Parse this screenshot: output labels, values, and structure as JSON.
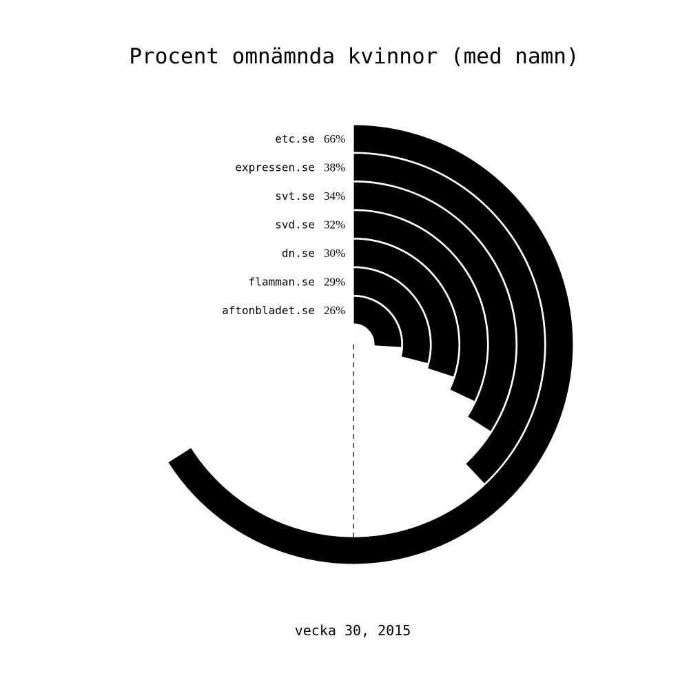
{
  "chart_data": {
    "type": "radial-bar",
    "title": "Procent omnämnda kvinnor (med namn)",
    "subtitle": "vecka 30, 2015",
    "categories": [
      "etc.se",
      "expressen.se",
      "svt.se",
      "svd.se",
      "dn.se",
      "flamman.se",
      "aftonbladet.se"
    ],
    "values": [
      66,
      38,
      34,
      32,
      30,
      29,
      26
    ],
    "value_labels": [
      "66%",
      "38%",
      "34%",
      "32%",
      "30%",
      "29%",
      "26%"
    ],
    "unit": "%",
    "max": 100,
    "colors": {
      "bar": "#000000",
      "separator": "#ffffff",
      "background": "#ffffff"
    }
  }
}
